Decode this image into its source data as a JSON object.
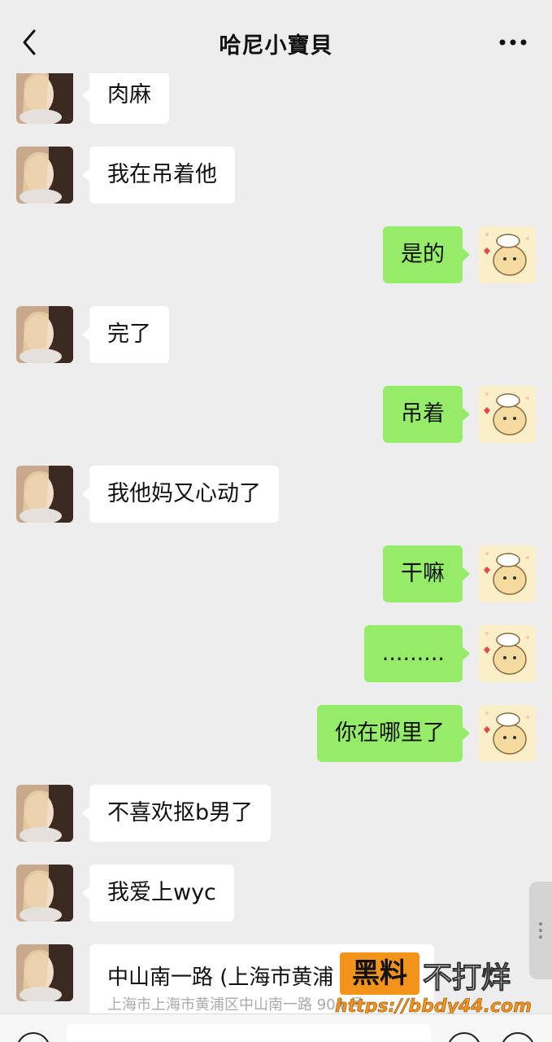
{
  "header": {
    "title": "哈尼小寶貝"
  },
  "messages": [
    {
      "dir": "in",
      "text": "肉麻"
    },
    {
      "dir": "in",
      "text": "我在吊着他"
    },
    {
      "dir": "out",
      "text": "是的"
    },
    {
      "dir": "in",
      "text": "完了"
    },
    {
      "dir": "out",
      "text": "吊着"
    },
    {
      "dir": "in",
      "text": "我他妈又心动了"
    },
    {
      "dir": "out",
      "text": "干嘛"
    },
    {
      "dir": "out",
      "text": "........."
    },
    {
      "dir": "out",
      "text": "你在哪里了"
    },
    {
      "dir": "in",
      "text": "不喜欢抠b男了"
    },
    {
      "dir": "in",
      "text": "我爱上wyc"
    }
  ],
  "location": {
    "name": "中山南一路 (上海市黄浦",
    "address": "上海市上海市黄浦区中山南一路 904 号"
  },
  "watermark": {
    "box_text": "黑料",
    "text": "不打烊",
    "url": "https://bbdy44.com"
  }
}
